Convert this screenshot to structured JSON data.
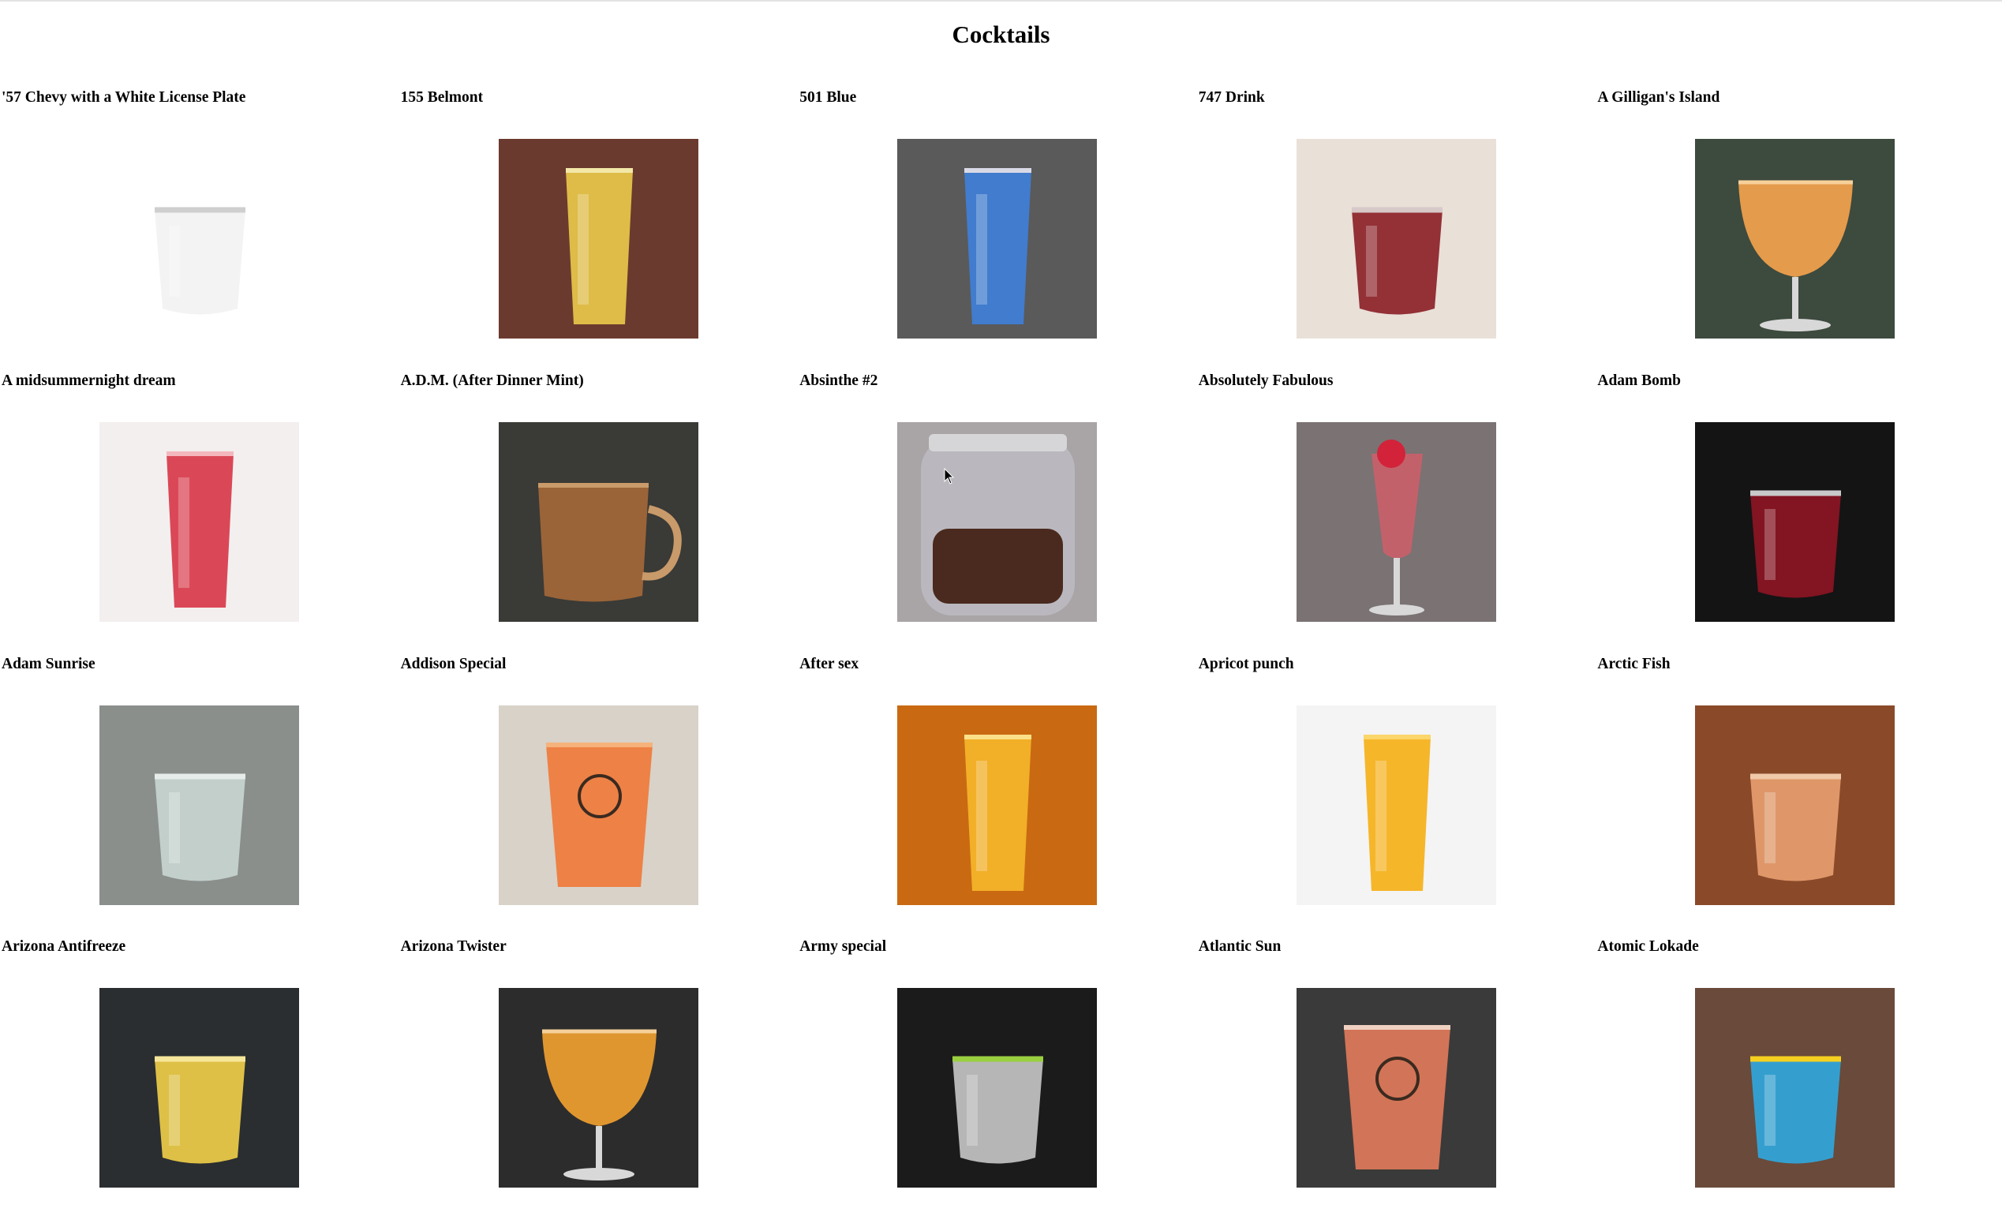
{
  "page": {
    "title": "Cocktails"
  },
  "cocktails": [
    {
      "name": "'57 Chevy with a White License Plate",
      "bg": "#ffffff",
      "drink": "#f2f2f2",
      "glass": "rocks",
      "rim": "#cfcfcf"
    },
    {
      "name": "155 Belmont",
      "bg": "#6b3a2e",
      "drink": "#e8c84a",
      "glass": "highball",
      "rim": "#f3e7a8"
    },
    {
      "name": "501 Blue",
      "bg": "#5a5a5a",
      "drink": "#3f7fd8",
      "glass": "highball",
      "rim": "#d9d9e6"
    },
    {
      "name": "747 Drink",
      "bg": "#e9e0d8",
      "drink": "#8a1e25",
      "glass": "rocks",
      "rim": "#d8c9c9"
    },
    {
      "name": "A Gilligan's Island",
      "bg": "#3d4a3e",
      "drink": "#f2a24c",
      "glass": "wine",
      "rim": "#f6d19a"
    },
    {
      "name": "A midsummernight dream",
      "bg": "#f3efef",
      "drink": "#d8394a",
      "glass": "highball",
      "rim": "#f4b7be"
    },
    {
      "name": "A.D.M. (After Dinner Mint)",
      "bg": "#3a3a36",
      "drink": "#9a6438",
      "glass": "mug",
      "rim": "#c99a6a"
    },
    {
      "name": "Absinthe #2",
      "bg": "#a9a4a6",
      "drink": "#4a2a1e",
      "glass": "jar",
      "rim": "#d6d6d8"
    },
    {
      "name": "Absolutely Fabulous",
      "bg": "#7b7273",
      "drink": "#c9606a",
      "glass": "flute",
      "rim": "#e0b0b5"
    },
    {
      "name": "Adam Bomb",
      "bg": "#141414",
      "drink": "#8f1424",
      "glass": "rocks",
      "rim": "#c9c9c9"
    },
    {
      "name": "Adam Sunrise",
      "bg": "#8a8f8c",
      "drink": "#c8d6d2",
      "glass": "rocks",
      "rim": "#e6ecea"
    },
    {
      "name": "Addison Special",
      "bg": "#d8d2c9",
      "drink": "#f07a3a",
      "glass": "cup",
      "rim": "#f5b27a"
    },
    {
      "name": "After sex",
      "bg": "#c96a12",
      "drink": "#f5b52a",
      "glass": "highball",
      "rim": "#fbe08a"
    },
    {
      "name": "Apricot punch",
      "bg": "#f4f4f4",
      "drink": "#f5b018",
      "glass": "highball",
      "rim": "#fbd66a"
    },
    {
      "name": "Arctic Fish",
      "bg": "#8a4a2a",
      "drink": "#e8a070",
      "glass": "rocks",
      "rim": "#f0c9a8"
    },
    {
      "name": "Arizona Antifreeze",
      "bg": "#2a2e30",
      "drink": "#f2d04a",
      "glass": "rocks",
      "rim": "#f5e69a"
    },
    {
      "name": "Arizona Twister",
      "bg": "#2c2c2c",
      "drink": "#f0a030",
      "glass": "wine",
      "rim": "#f5d09a"
    },
    {
      "name": "Army special",
      "bg": "#1b1b1b",
      "drink": "#c8c8c8",
      "glass": "rocks",
      "rim": "#9ad040"
    },
    {
      "name": "Atlantic Sun",
      "bg": "#3a3a3a",
      "drink": "#e07a5a",
      "glass": "cup",
      "rim": "#f0d0c0"
    },
    {
      "name": "Atomic Lokade",
      "bg": "#6a4a3a",
      "drink": "#2fa8e0",
      "glass": "rocks",
      "rim": "#f5d020"
    }
  ]
}
